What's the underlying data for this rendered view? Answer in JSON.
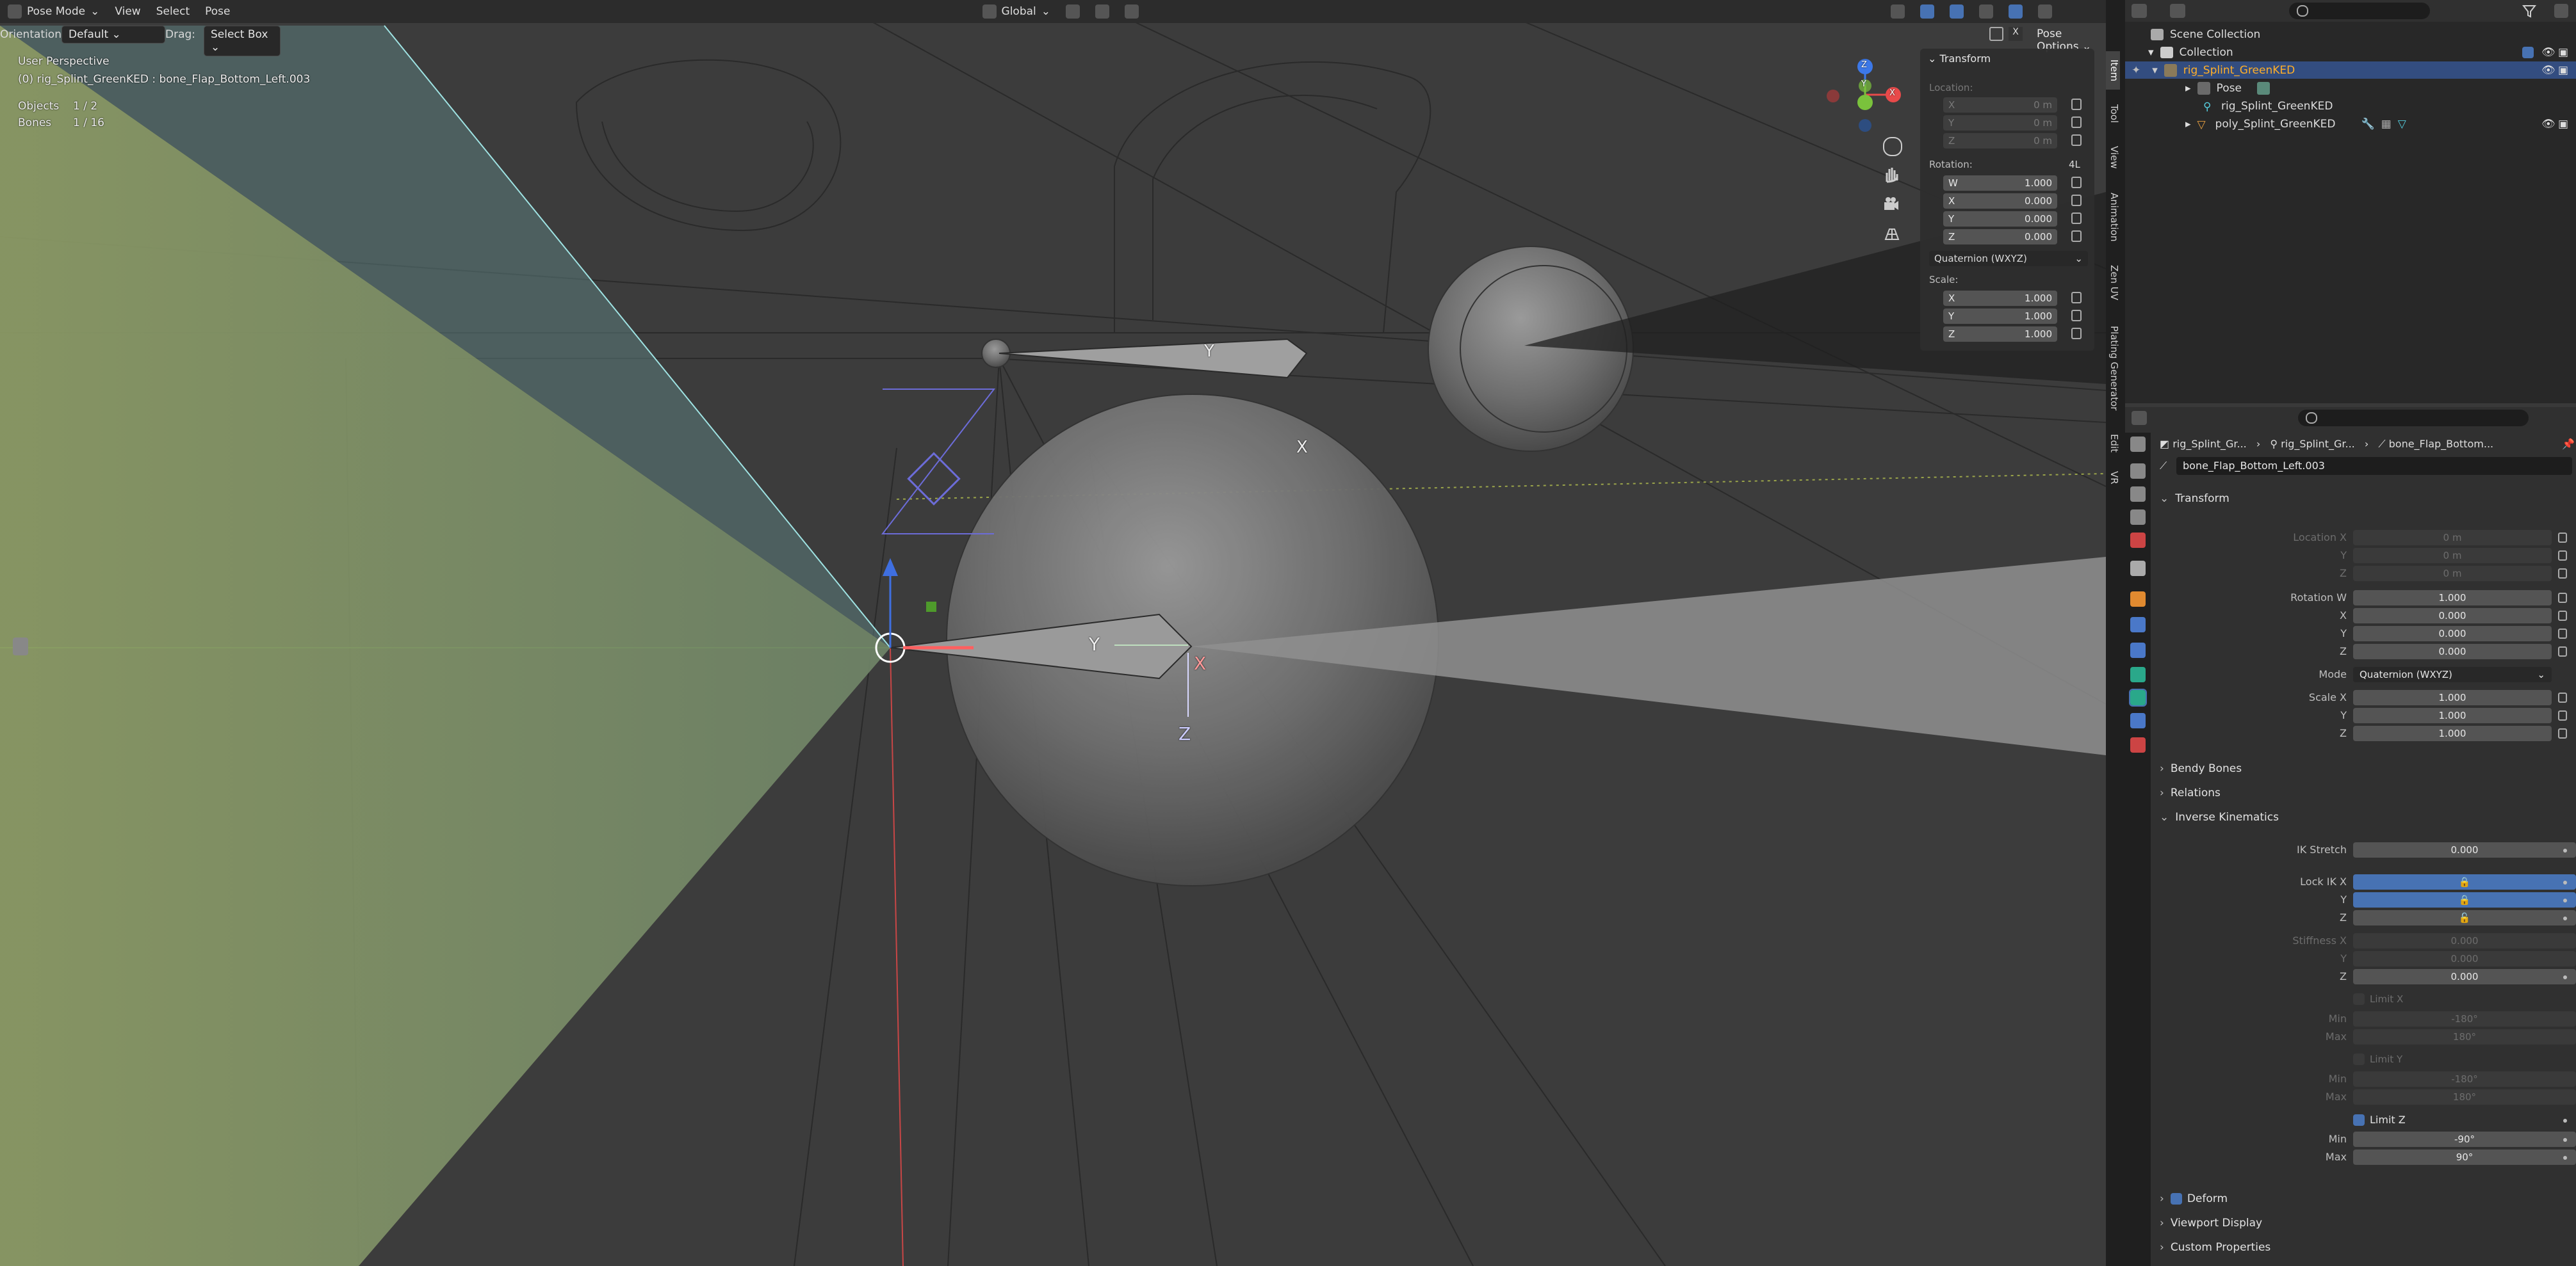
{
  "header": {
    "mode": "Pose Mode",
    "menus": [
      "View",
      "Select",
      "Pose"
    ],
    "transform_orientation": "Global",
    "pose_options": "Pose Options"
  },
  "toolbar": {
    "orientation_label": "Orientation:",
    "orientation_value": "Default",
    "drag_label": "Drag:",
    "drag_value": "Select Box"
  },
  "overlay": {
    "perspective": "User Perspective",
    "active": "(0) rig_Splint_GreenKED : bone_Flap_Bottom_Left.003",
    "objects_label": "Objects",
    "objects_value": "1 / 2",
    "bones_label": "Bones",
    "bones_value": "1 / 16"
  },
  "viewport_labels": {
    "y_upper": "Y",
    "x_upper": "X",
    "y_main": "Y",
    "x_main": "X",
    "z_main": "Z"
  },
  "gizmo": {
    "z": "Z",
    "y": "Y",
    "x": "X"
  },
  "npanel": {
    "title": "Transform",
    "location_label": "Location:",
    "location": [
      {
        "axis": "X",
        "value": "0 m"
      },
      {
        "axis": "Y",
        "value": "0 m"
      },
      {
        "axis": "Z",
        "value": "0 m"
      }
    ],
    "rotation_label": "Rotation:",
    "rotation_mode_short": "4L",
    "rotation": [
      {
        "axis": "W",
        "value": "1.000"
      },
      {
        "axis": "X",
        "value": "0.000"
      },
      {
        "axis": "Y",
        "value": "0.000"
      },
      {
        "axis": "Z",
        "value": "0.000"
      }
    ],
    "rotation_mode": "Quaternion (WXYZ)",
    "scale_label": "Scale:",
    "scale": [
      {
        "axis": "X",
        "value": "1.000"
      },
      {
        "axis": "Y",
        "value": "1.000"
      },
      {
        "axis": "Z",
        "value": "1.000"
      }
    ]
  },
  "side_tabs": [
    "Item",
    "Tool",
    "View",
    "Animation",
    "Zen UV",
    "Plating Generator",
    "Edit",
    "VR"
  ],
  "outliner": {
    "rows": [
      {
        "label": "Scene Collection"
      },
      {
        "label": "Collection"
      },
      {
        "label": "rig_Splint_GreenKED"
      },
      {
        "label": "Pose"
      },
      {
        "label": "rig_Splint_GreenKED"
      },
      {
        "label": "poly_Splint_GreenKED"
      }
    ]
  },
  "properties": {
    "breadcrumb": [
      "rig_Splint_Gr...",
      "rig_Splint_Gr...",
      "bone_Flap_Bottom..."
    ],
    "bone_name": "bone_Flap_Bottom_Left.003",
    "transform": {
      "title": "Transform",
      "location_x_label": "Location X",
      "location": [
        "0 m",
        "0 m",
        "0 m"
      ],
      "rotation_w_label": "Rotation W",
      "rotation": [
        "1.000",
        "0.000",
        "0.000",
        "0.000"
      ],
      "mode_label": "Mode",
      "mode_value": "Quaternion (WXYZ)",
      "scale_x_label": "Scale X",
      "scale": [
        "1.000",
        "1.000",
        "1.000"
      ],
      "y_label": "Y",
      "z_label": "Z",
      "x_label": "X"
    },
    "bendy_bones": "Bendy Bones",
    "relations": "Relations",
    "ik": {
      "title": "Inverse Kinematics",
      "ik_stretch_label": "IK Stretch",
      "ik_stretch": "0.000",
      "lock_ik_x_label": "Lock IK X",
      "stiffness_x_label": "Stiffness X",
      "stiffness": [
        "0.000",
        "0.000",
        "0.000"
      ],
      "limit_x": "Limit X",
      "limit_y": "Limit Y",
      "limit_z": "Limit Z",
      "min_label": "Min",
      "max_label": "Max",
      "limit_x_min": "-180°",
      "limit_x_max": "180°",
      "limit_y_min": "-180°",
      "limit_y_max": "180°",
      "limit_z_min": "-90°",
      "limit_z_max": "90°"
    },
    "deform": "Deform",
    "viewport_display": "Viewport Display",
    "custom_properties": "Custom Properties"
  },
  "colors": {
    "selection_blue": "#4772b3",
    "active_orange": "#ffaf29",
    "viewport_bg": "#3c3c3c",
    "cone_fill": "#8b9a64"
  }
}
